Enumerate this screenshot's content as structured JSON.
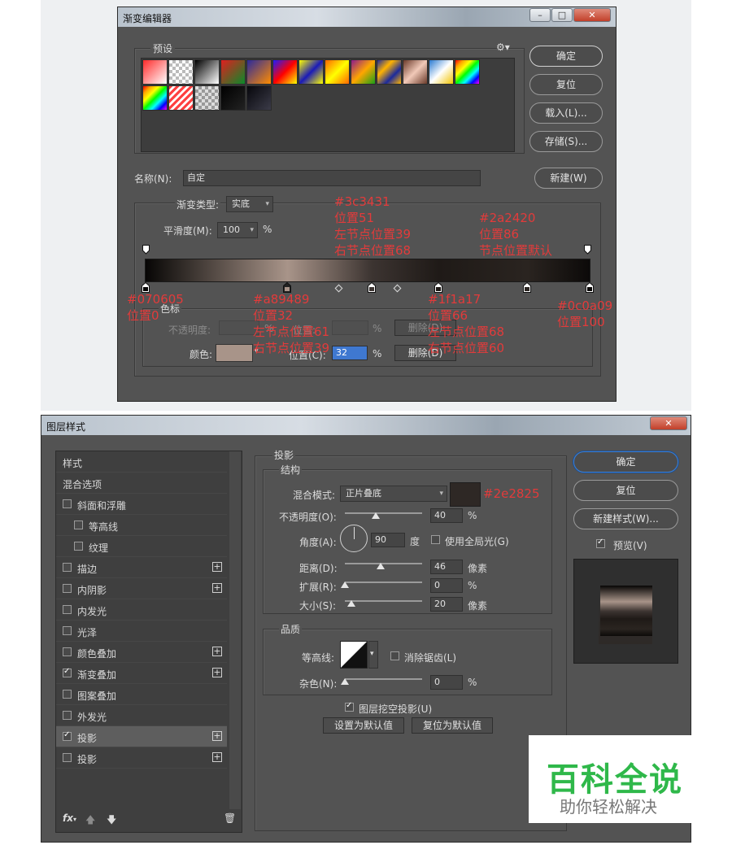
{
  "gradient_editor": {
    "title": "渐变编辑器",
    "presets_label": "预设",
    "buttons": {
      "ok": "确定",
      "reset": "复位",
      "load": "载入(L)...",
      "save": "存储(S)...",
      "new": "新建(W)"
    },
    "name_label": "名称(N):",
    "name_value": "自定",
    "type_label": "渐变类型:",
    "type_value": "实底",
    "smooth_label": "平滑度(M):",
    "smooth_value": "100",
    "smooth_unit": "%",
    "stops_group": "色标",
    "opacity_label": "不透明度:",
    "opacity_unit": "%",
    "position_label_dim": "位置:",
    "delete_dim": "删除(D)",
    "color_label": "颜色:",
    "color_value": "#a89489",
    "position_label": "位置(C):",
    "position_value": "32",
    "position_unit": "%",
    "delete_label": "删除(D)",
    "gradient_stops": [
      {
        "color": "#070605",
        "pos": 0
      },
      {
        "color": "#a89489",
        "pos": 32
      },
      {
        "color": "#3c3431",
        "pos": 51
      },
      {
        "color": "#1f1a17",
        "pos": 66
      },
      {
        "color": "#2a2420",
        "pos": 86
      },
      {
        "color": "#0c0a09",
        "pos": 100
      }
    ],
    "annotations": {
      "a1": [
        "#070605",
        "位置0"
      ],
      "a2": [
        "#a89489",
        "位置32",
        "左节点位置61",
        "右节点位置39"
      ],
      "a3": [
        "#3c3431",
        "位置51",
        "左节点位置39",
        "右节点位置68"
      ],
      "a4": [
        "#1f1a17",
        "位置66",
        "左节点位置68",
        "右节点位置60"
      ],
      "a5": [
        "#2a2420",
        "位置86",
        "节点位置默认"
      ],
      "a6": [
        "#0c0a09",
        "位置100"
      ]
    }
  },
  "layer_style": {
    "title": "图层样式",
    "list": [
      {
        "label": "样式",
        "check": null,
        "plus": false,
        "indent": 0
      },
      {
        "label": "混合选项",
        "check": null,
        "plus": false,
        "indent": 0
      },
      {
        "label": "斜面和浮雕",
        "check": false,
        "plus": false,
        "indent": 0
      },
      {
        "label": "等高线",
        "check": false,
        "plus": false,
        "indent": 1
      },
      {
        "label": "纹理",
        "check": false,
        "plus": false,
        "indent": 1
      },
      {
        "label": "描边",
        "check": false,
        "plus": true,
        "indent": 0
      },
      {
        "label": "内阴影",
        "check": false,
        "plus": true,
        "indent": 0
      },
      {
        "label": "内发光",
        "check": false,
        "plus": false,
        "indent": 0
      },
      {
        "label": "光泽",
        "check": false,
        "plus": false,
        "indent": 0
      },
      {
        "label": "颜色叠加",
        "check": false,
        "plus": true,
        "indent": 0
      },
      {
        "label": "渐变叠加",
        "check": true,
        "plus": true,
        "indent": 0
      },
      {
        "label": "图案叠加",
        "check": false,
        "plus": false,
        "indent": 0
      },
      {
        "label": "外发光",
        "check": false,
        "plus": false,
        "indent": 0
      },
      {
        "label": "投影",
        "check": true,
        "plus": true,
        "indent": 0,
        "selected": true
      },
      {
        "label": "投影",
        "check": false,
        "plus": true,
        "indent": 0
      }
    ],
    "section_title": "投影",
    "structure_title": "结构",
    "blend_label": "混合模式:",
    "blend_value": "正片叠底",
    "shadow_color": "#2e2825",
    "shadow_color_note": "#2e2825",
    "opacity_label": "不透明度(O):",
    "opacity_value": "40",
    "opacity_level": 0.4,
    "angle_label": "角度(A):",
    "angle_value": "90",
    "angle_unit": "度",
    "global_light_label": "使用全局光(G)",
    "distance_label": "距离(D):",
    "distance_value": "46",
    "distance_level": 0.46,
    "spread_label": "扩展(R):",
    "spread_value": "0",
    "spread_level": 0,
    "size_label": "大小(S):",
    "size_value": "20",
    "size_level": 0.08,
    "px_unit": "像素",
    "pct_unit": "%",
    "quality_title": "品质",
    "contour_label": "等高线:",
    "antialias_label": "消除锯齿(L)",
    "noise_label": "杂色(N):",
    "noise_value": "0",
    "noise_level": 0,
    "knockout_label": "图层挖空投影(U)",
    "set_default": "设置为默认值",
    "reset_default": "复位为默认值",
    "buttons": {
      "ok": "确定",
      "reset": "复位",
      "new_style": "新建样式(W)...",
      "preview": "预览(V)"
    }
  },
  "watermark": {
    "title": "百科全说",
    "subtitle": "助你轻松解决"
  }
}
